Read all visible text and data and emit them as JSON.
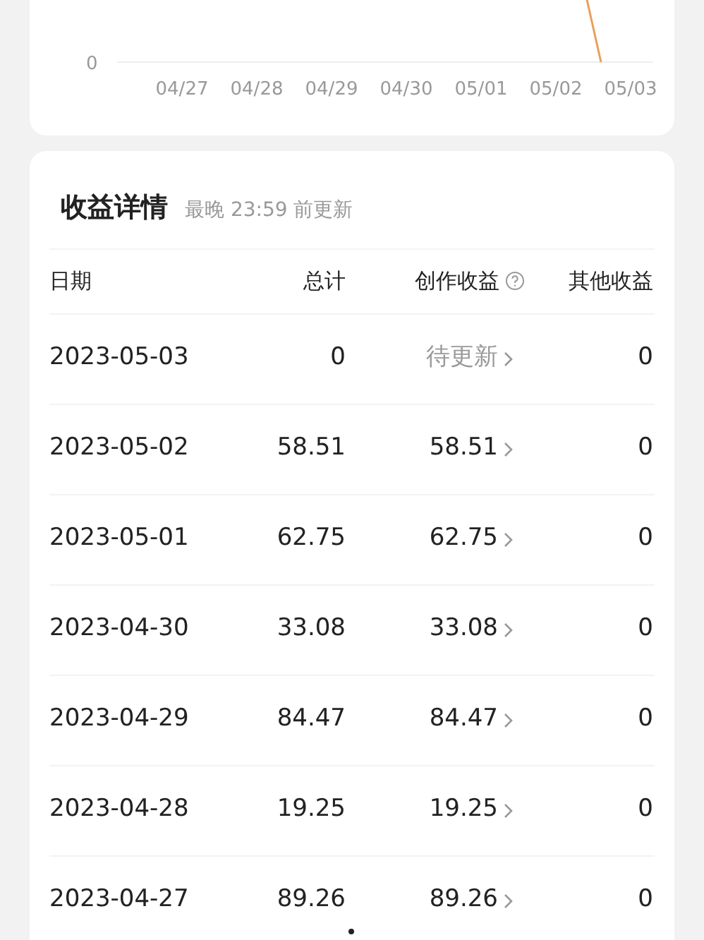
{
  "chart": {
    "y_label": "0",
    "x_labels": [
      "04/27",
      "04/28",
      "04/29",
      "04/30",
      "05/01",
      "05/02",
      "05/03"
    ]
  },
  "details": {
    "title": "收益详情",
    "subtitle": "最晚 23:59 前更新",
    "columns": [
      "日期",
      "总计",
      "创作收益",
      "其他收益"
    ],
    "rows": [
      {
        "date": "2023-05-03",
        "total": "0",
        "creative": "待更新",
        "pending": true,
        "other": "0"
      },
      {
        "date": "2023-05-02",
        "total": "58.51",
        "creative": "58.51",
        "pending": false,
        "other": "0"
      },
      {
        "date": "2023-05-01",
        "total": "62.75",
        "creative": "62.75",
        "pending": false,
        "other": "0"
      },
      {
        "date": "2023-04-30",
        "total": "33.08",
        "creative": "33.08",
        "pending": false,
        "other": "0"
      },
      {
        "date": "2023-04-29",
        "total": "84.47",
        "creative": "84.47",
        "pending": false,
        "other": "0"
      },
      {
        "date": "2023-04-28",
        "total": "19.25",
        "creative": "19.25",
        "pending": false,
        "other": "0"
      },
      {
        "date": "2023-04-27",
        "total": "89.26",
        "creative": "89.26",
        "pending": false,
        "other": "0"
      }
    ]
  }
}
